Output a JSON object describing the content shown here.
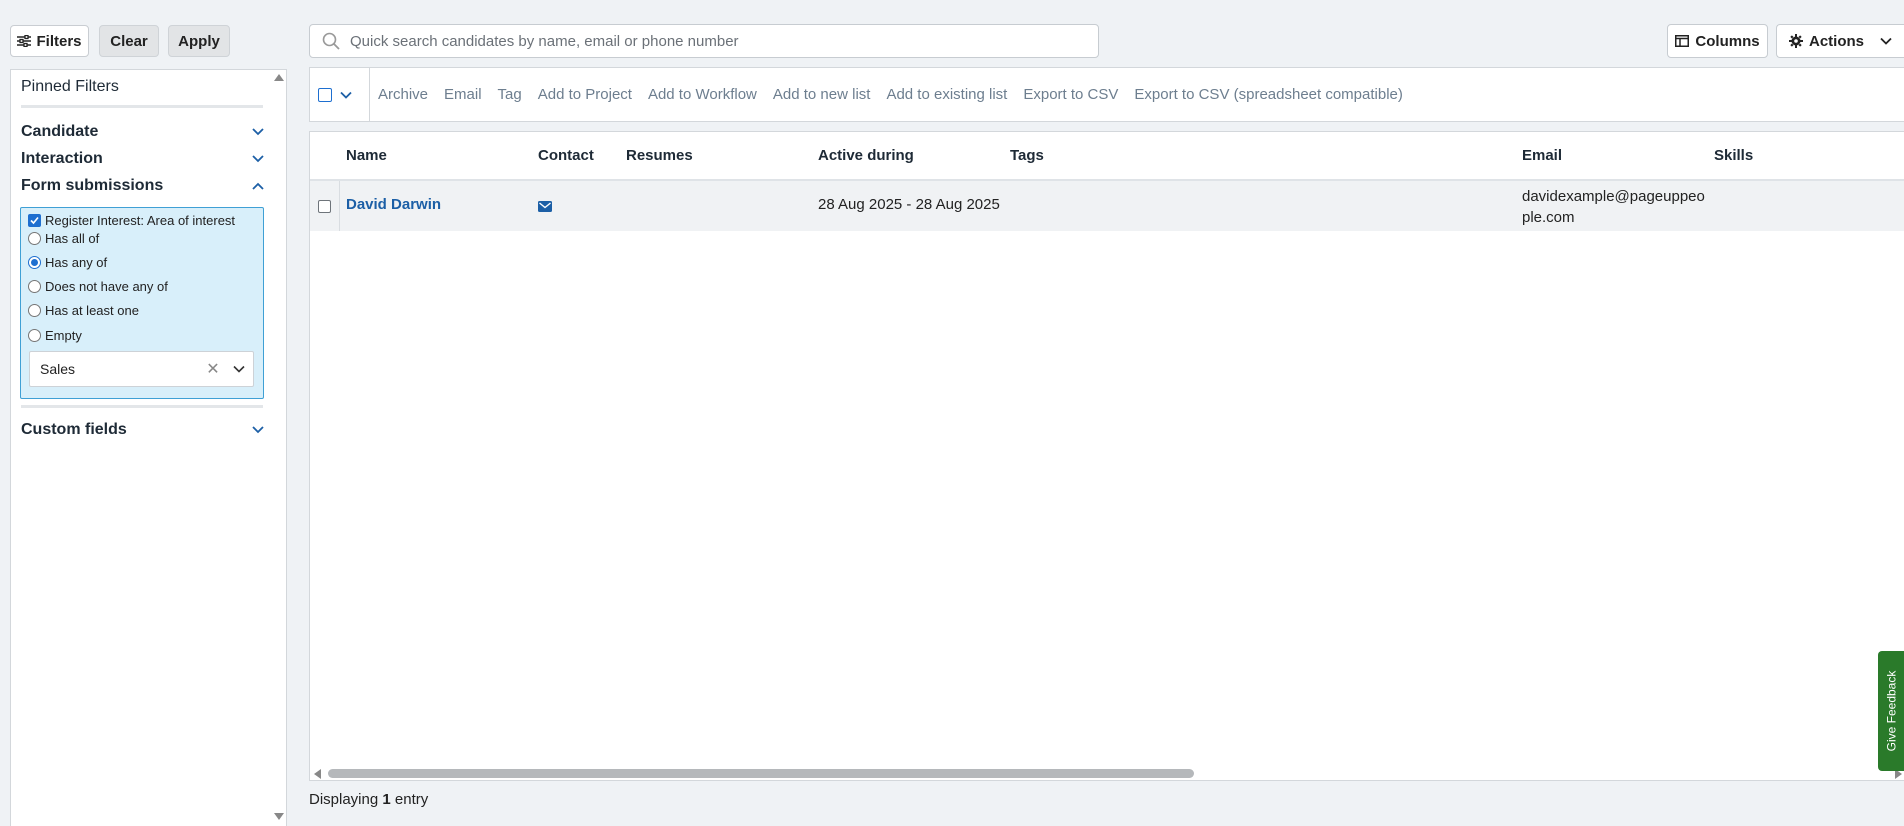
{
  "toolbar": {
    "filters_label": "Filters",
    "clear_label": "Clear",
    "apply_label": "Apply",
    "search_placeholder": "Quick search candidates by name, email or phone number",
    "columns_label": "Columns",
    "actions_label": "Actions"
  },
  "sidebar": {
    "pinned_title": "Pinned Filters",
    "sections": {
      "candidate": "Candidate",
      "interaction": "Interaction",
      "form_submissions": "Form submissions",
      "custom_fields": "Custom fields"
    },
    "form_filter": {
      "field_label": "Register Interest: Area of interest",
      "field_checked": true,
      "options": [
        "Has all of",
        "Has any of",
        "Does not have any of",
        "Has at least one",
        "Empty"
      ],
      "selected_option": "Has any of",
      "selected_value": "Sales"
    }
  },
  "bulk_actions": [
    "Archive",
    "Email",
    "Tag",
    "Add to Project",
    "Add to Workflow",
    "Add to new list",
    "Add to existing list",
    "Export to CSV",
    "Export to CSV (spreadsheet compatible)"
  ],
  "table": {
    "columns": [
      "Name",
      "Contact",
      "Resumes",
      "Active during",
      "Tags",
      "Email",
      "Skills"
    ],
    "rows": [
      {
        "name": "David Darwin",
        "contact_icon": "envelope-icon",
        "resumes": "",
        "active_during": "28 Aug 2025 - 28 Aug 2025",
        "tags": "",
        "email": "davidexample@pageuppeople.com",
        "skills": ""
      }
    ]
  },
  "footer": {
    "prefix": "Displaying",
    "count": "1",
    "suffix": "entry"
  },
  "feedback_label": "Give Feedback",
  "colors": {
    "link": "#1c5fa6",
    "filter_box_bg": "#d8effa",
    "filter_box_border": "#3fa0d5",
    "feedback_bg": "#2a7a2a"
  }
}
